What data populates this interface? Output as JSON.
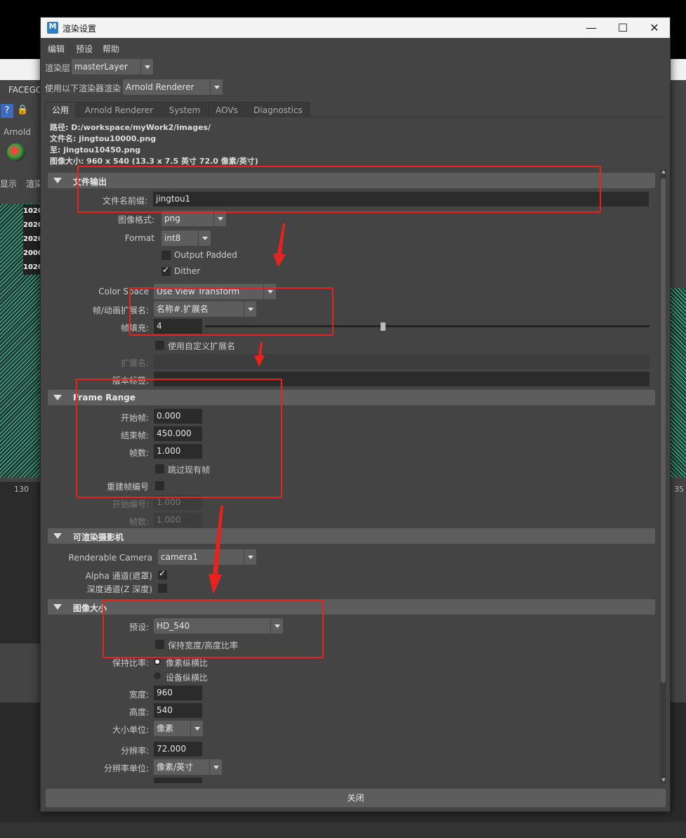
{
  "background": {
    "facego": "FACEGO",
    "help": "?",
    "arnold": "Arnold",
    "display": "显示",
    "render": "渲染",
    "frames": [
      "1020",
      "2020",
      "2020",
      "2000",
      "1020"
    ],
    "timeline_left": "130",
    "timeline_right": "35"
  },
  "window": {
    "title": "渲染设置",
    "app_icon": "M",
    "minimize": "—",
    "maximize": "☐",
    "close": "✕"
  },
  "menu": [
    "编辑",
    "预设",
    "帮助"
  ],
  "render_layer": {
    "label": "渲染层",
    "value": "masterLayer"
  },
  "renderer": {
    "label": "使用以下渲染器渲染",
    "value": "Arnold Renderer"
  },
  "tabs": [
    {
      "label": "公用",
      "active": true
    },
    {
      "label": "Arnold Renderer"
    },
    {
      "label": "System"
    },
    {
      "label": "AOVs"
    },
    {
      "label": "Diagnostics"
    }
  ],
  "info": {
    "path": "路径: D:/workspace/myWork2/images/",
    "filename": "文件名: jingtou10000.png",
    "to": "至: jingtou10450.png",
    "image_size": "图像大小: 960 x 540 (13.3 x 7.5 英寸 72.0 像素/英寸)"
  },
  "file_output": {
    "title": "文件输出",
    "prefix_label": "文件名前缀:",
    "prefix_value": "jingtou1",
    "image_format_label": "图像格式:",
    "image_format_value": "png",
    "format_label": "Format",
    "format_value": "int8",
    "output_padded": "Output Padded",
    "dither": "Dither",
    "color_space_label": "Color Space",
    "color_space_value": "Use View Transform",
    "frame_ext_label": "帧/动画扩展名:",
    "frame_ext_value": "名称#.扩展名",
    "frame_padding_label": "帧填充:",
    "frame_padding_value": "4",
    "frame_padding_slider": 0.4,
    "custom_ext": "使用自定义扩展名",
    "ext_label": "扩展名:",
    "version_label": "版本标签:"
  },
  "frame_range": {
    "title": "Frame Range",
    "start_label": "开始帧:",
    "start_value": "0.000",
    "end_label": "结束帧:",
    "end_value": "450.000",
    "by_label": "帧数:",
    "by_value": "1.000",
    "skip_existing": "跳过现有帧",
    "renumber_label": "重建帧编号",
    "start_number_label": "开始编号:",
    "start_number_value": "1.000",
    "by_number_label": "帧数:",
    "by_number_value": "1.000"
  },
  "camera": {
    "title": "可渲染摄影机",
    "renderable_label": "Renderable Camera",
    "renderable_value": "camera1",
    "alpha_label": "Alpha 通道(遮罩)",
    "depth_label": "深度通道(Z 深度)"
  },
  "image_size": {
    "title": "图像大小",
    "preset_label": "预设:",
    "preset_value": "HD_540",
    "keep_ratio": "保持宽度/高度比率",
    "keep_ratio_label": "保持比率:",
    "pixel_aspect": "像素纵横比",
    "device_aspect": "设备纵横比",
    "width_label": "宽度:",
    "width_value": "960",
    "height_label": "高度:",
    "height_value": "540",
    "size_units_label": "大小单位:",
    "size_units_value": "像素",
    "resolution_label": "分辨率:",
    "resolution_value": "72.000",
    "res_units_label": "分辨率单位:",
    "res_units_value": "像素/英寸"
  },
  "close_button": "关闭",
  "colors": {
    "annotation": "#e8231d",
    "panel": "#444444",
    "field": "#2b2b2b"
  }
}
